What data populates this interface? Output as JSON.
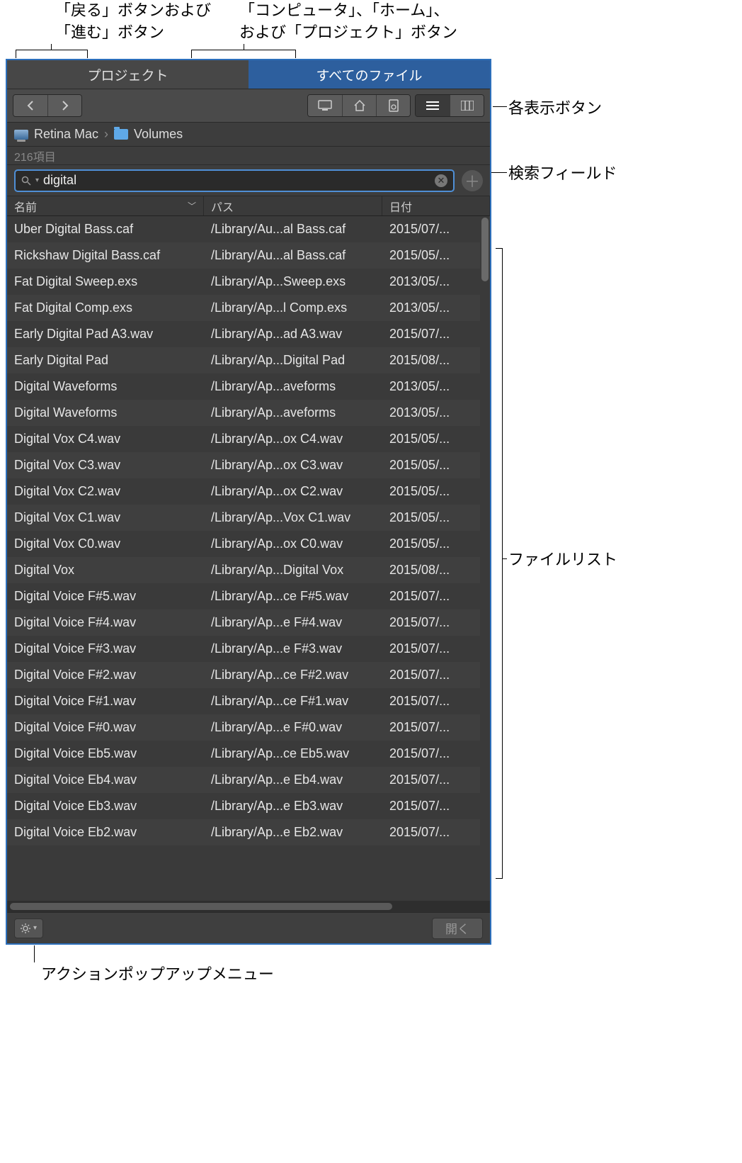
{
  "callouts": {
    "back_forward": "「戻る」ボタンおよび\n「進む」ボタン",
    "location_buttons": "「コンピュータ」、「ホーム」、\nおよび「プロジェクト」ボタン",
    "view_buttons": "各表示ボタン",
    "search_field": "検索フィールド",
    "file_list": "ファイルリスト",
    "action_menu": "アクションポップアップメニュー"
  },
  "tabs": {
    "project": "プロジェクト",
    "all_files": "すべてのファイル"
  },
  "path": {
    "computer": "Retina Mac",
    "folder": "Volumes"
  },
  "count_label": "216項目",
  "search": {
    "value": "digital "
  },
  "columns": {
    "name": "名前",
    "path": "パス",
    "date": "日付"
  },
  "footer": {
    "open": "開く"
  },
  "files": [
    {
      "name": "Uber Digital Bass.caf",
      "path": "/Library/Au...al Bass.caf",
      "date": "2015/07/..."
    },
    {
      "name": "Rickshaw Digital Bass.caf",
      "path": "/Library/Au...al Bass.caf",
      "date": "2015/05/..."
    },
    {
      "name": "Fat Digital Sweep.exs",
      "path": "/Library/Ap...Sweep.exs",
      "date": "2013/05/..."
    },
    {
      "name": "Fat Digital Comp.exs",
      "path": "/Library/Ap...l Comp.exs",
      "date": "2013/05/..."
    },
    {
      "name": "Early Digital Pad A3.wav",
      "path": "/Library/Ap...ad A3.wav",
      "date": "2015/07/..."
    },
    {
      "name": "Early Digital Pad",
      "path": "/Library/Ap...Digital Pad",
      "date": "2015/08/..."
    },
    {
      "name": "Digital Waveforms",
      "path": "/Library/Ap...aveforms",
      "date": "2013/05/..."
    },
    {
      "name": "Digital Waveforms",
      "path": "/Library/Ap...aveforms",
      "date": "2013/05/..."
    },
    {
      "name": "Digital Vox C4.wav",
      "path": "/Library/Ap...ox C4.wav",
      "date": "2015/05/..."
    },
    {
      "name": "Digital Vox C3.wav",
      "path": "/Library/Ap...ox C3.wav",
      "date": "2015/05/..."
    },
    {
      "name": "Digital Vox C2.wav",
      "path": "/Library/Ap...ox C2.wav",
      "date": "2015/05/..."
    },
    {
      "name": "Digital Vox C1.wav",
      "path": "/Library/Ap...Vox C1.wav",
      "date": "2015/05/..."
    },
    {
      "name": "Digital Vox C0.wav",
      "path": "/Library/Ap...ox C0.wav",
      "date": "2015/05/..."
    },
    {
      "name": "Digital Vox",
      "path": "/Library/Ap...Digital Vox",
      "date": "2015/08/..."
    },
    {
      "name": "Digital Voice F#5.wav",
      "path": "/Library/Ap...ce F#5.wav",
      "date": "2015/07/..."
    },
    {
      "name": "Digital Voice F#4.wav",
      "path": "/Library/Ap...e F#4.wav",
      "date": "2015/07/..."
    },
    {
      "name": "Digital Voice F#3.wav",
      "path": "/Library/Ap...e F#3.wav",
      "date": "2015/07/..."
    },
    {
      "name": "Digital Voice F#2.wav",
      "path": "/Library/Ap...ce F#2.wav",
      "date": "2015/07/..."
    },
    {
      "name": "Digital Voice F#1.wav",
      "path": "/Library/Ap...ce F#1.wav",
      "date": "2015/07/..."
    },
    {
      "name": "Digital Voice F#0.wav",
      "path": "/Library/Ap...e F#0.wav",
      "date": "2015/07/..."
    },
    {
      "name": "Digital Voice Eb5.wav",
      "path": "/Library/Ap...ce Eb5.wav",
      "date": "2015/07/..."
    },
    {
      "name": "Digital Voice Eb4.wav",
      "path": "/Library/Ap...e Eb4.wav",
      "date": "2015/07/..."
    },
    {
      "name": "Digital Voice Eb3.wav",
      "path": "/Library/Ap...e Eb3.wav",
      "date": "2015/07/..."
    },
    {
      "name": "Digital Voice Eb2.wav",
      "path": "/Library/Ap...e Eb2.wav",
      "date": "2015/07/..."
    }
  ]
}
